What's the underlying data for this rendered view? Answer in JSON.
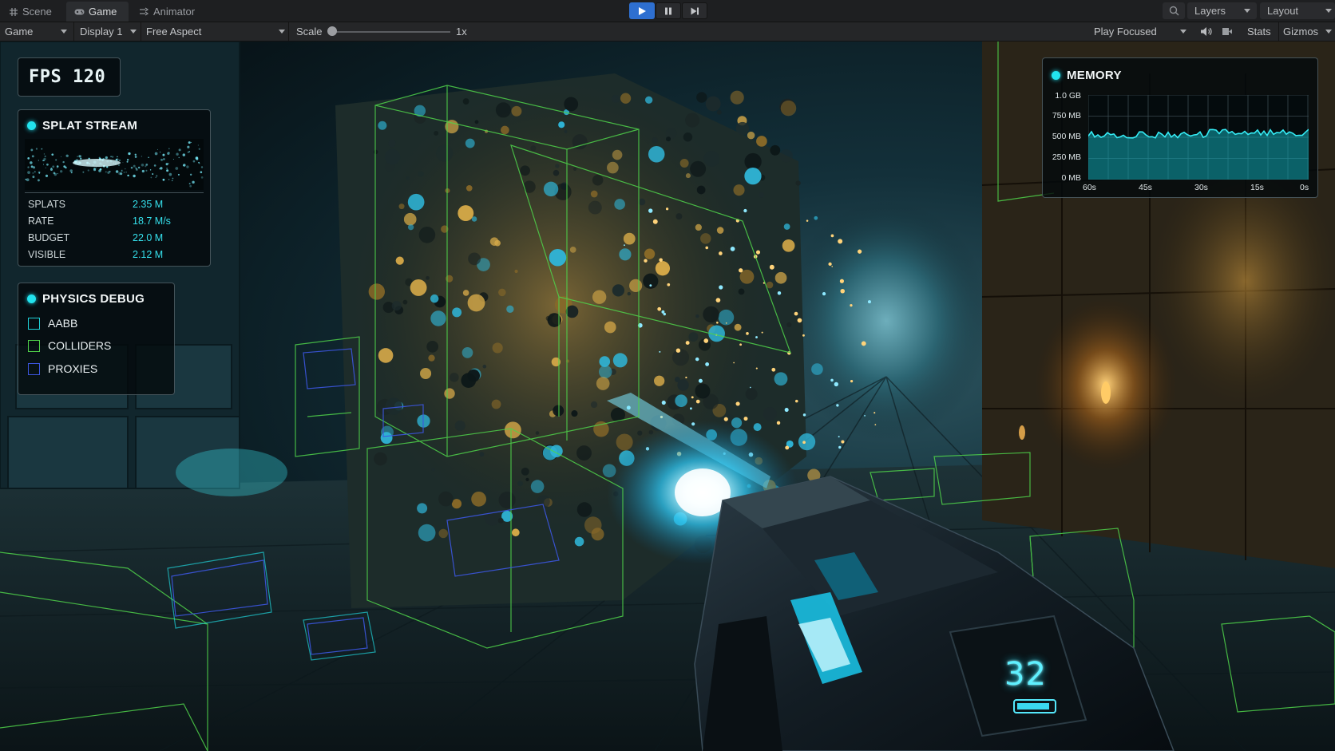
{
  "tabs": [
    {
      "label": "Scene",
      "icon": "grid-icon",
      "active": false
    },
    {
      "label": "Game",
      "icon": "gamepad-icon",
      "active": true
    },
    {
      "label": "Animator",
      "icon": "animator-icon",
      "active": false
    }
  ],
  "topbar": {
    "layers_label": "Layers",
    "layout_label": "Layout"
  },
  "toolbar": {
    "view_label": "Game",
    "display_label": "Display 1",
    "aspect_label": "Free Aspect",
    "scale_label": "Scale",
    "scale_value": "1x",
    "scale_slider_value": 0.0,
    "play_mode_label": "Play Focused",
    "stats_label": "Stats",
    "gizmos_label": "Gizmos"
  },
  "hud": {
    "fps_text": "FPS 120",
    "splat_stream": {
      "title": "SPLAT STREAM",
      "rows": [
        {
          "key": "SPLATS",
          "value": "2.35 M"
        },
        {
          "key": "RATE",
          "value": "18.7 M/s"
        },
        {
          "key": "BUDGET",
          "value": "22.0 M"
        },
        {
          "key": "VISIBLE",
          "value": "2.12 M"
        }
      ]
    },
    "physics_debug": {
      "title": "PHYSICS DEBUG",
      "items": [
        {
          "label": "AABB",
          "color": "#1fd2d8"
        },
        {
          "label": "COLLIDERS",
          "color": "#4fd24a"
        },
        {
          "label": "PROXIES",
          "color": "#3c56e0"
        }
      ]
    },
    "memory": {
      "title": "MEMORY",
      "y_labels": [
        "1.0 GB",
        "750 MB",
        "500 MB",
        "250 MB",
        "0 MB"
      ],
      "x_labels": [
        "60s",
        "45s",
        "30s",
        "15s",
        "0s"
      ]
    },
    "ammo_count": "32"
  },
  "colors": {
    "accent_cyan": "#22e3ee",
    "collider_green": "#4fd24a",
    "proxy_blue": "#3c56e0",
    "play_button": "#2e6fd0"
  }
}
